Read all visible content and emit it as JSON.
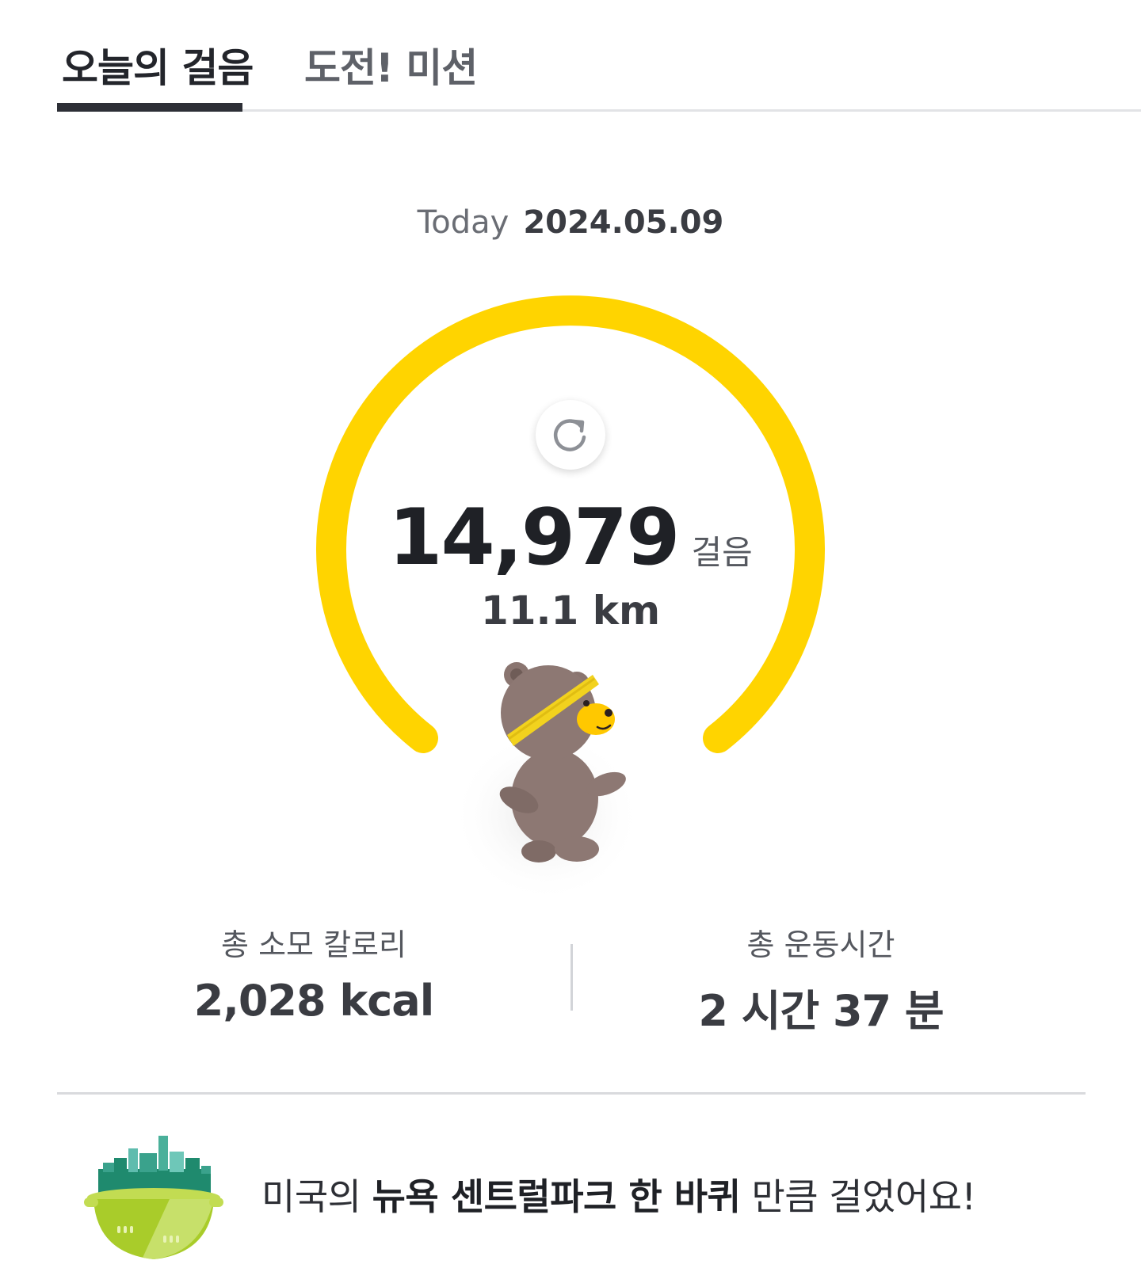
{
  "tabs": [
    {
      "label": "오늘의 걸음",
      "active": true
    },
    {
      "label": "도전! 미션",
      "active": false
    }
  ],
  "date": {
    "label": "Today",
    "value": "2024.05.09"
  },
  "gauge": {
    "accent_color": "#FFD400",
    "refresh_icon": "refresh-icon",
    "steps": "14,979",
    "steps_unit": "걸음",
    "distance": "11.1 km",
    "mascot": "bear-mascot-running-with-headband"
  },
  "stats": {
    "calories": {
      "label": "총 소모 칼로리",
      "value": "2,028 kcal"
    },
    "exercise_time": {
      "label": "총 운동시간",
      "value": "2 시간 37 분"
    }
  },
  "achievement": {
    "icon": "park-landmark-icon",
    "prefix": "미국의 ",
    "highlight": "뉴욕 센트럴파크 한 바퀴",
    "suffix": " 만큼 걸었어요!"
  }
}
